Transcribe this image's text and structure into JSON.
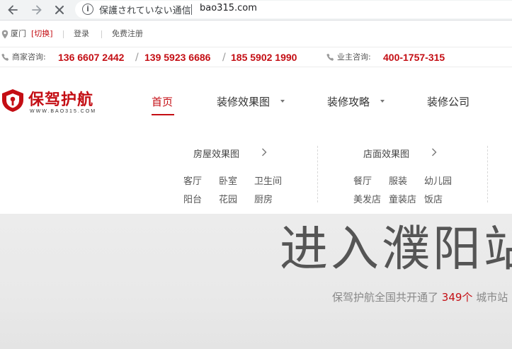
{
  "browser": {
    "security_text": "保護されていない通信",
    "url": "bao315.com"
  },
  "top_links": {
    "city": "厦门",
    "switch": "[切换]",
    "login": "登录",
    "register": "免费注册"
  },
  "phones": {
    "merchant_label": "商家咨询:",
    "merchant_numbers": [
      "136 6607 2442",
      "139 5923 6686",
      "185 5902 1990"
    ],
    "separator": "/",
    "owner_label": "业主咨询:",
    "owner_number": "400-1757-315"
  },
  "header": {
    "logo_text": "保驾护航",
    "logo_sub": "WWW.BAO315.COM",
    "nav": [
      "首页",
      "装修效果图",
      "装修攻略",
      "装修公司"
    ]
  },
  "dropdown": {
    "groups": [
      {
        "title": "房屋效果图",
        "items": [
          "客厅",
          "卧室",
          "卫生间",
          "阳台",
          "花园",
          "厨房"
        ]
      },
      {
        "title": "店面效果图",
        "items": [
          "餐厅",
          "服装",
          "幼儿园",
          "美发店",
          "童装店",
          "饭店"
        ]
      }
    ]
  },
  "hero": {
    "title": "进入濮阳站",
    "sub_prefix": "保驾护航全国共开通了",
    "sub_count": "349个",
    "sub_suffix": "城市站"
  },
  "colors": {
    "brand_red": "#c40e14",
    "text_dark": "#333333",
    "hero_bg": "#eaeaea"
  },
  "icons": [
    "back-arrow-icon",
    "forward-arrow-icon",
    "close-icon",
    "info-icon",
    "location-pin-icon",
    "phone-icon",
    "shield-logo-icon",
    "chevron-right-icon",
    "caret-down-icon"
  ]
}
